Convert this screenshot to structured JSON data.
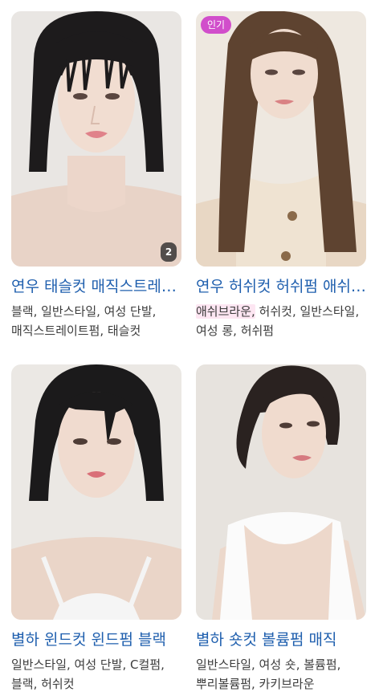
{
  "cards": [
    {
      "title": "연우 태슬컷 매직스트레이트펌",
      "tags": "블랙, 일반스타일, 여성 단발, 매직스트레이트펌, 태슬컷",
      "photo_count": "2"
    },
    {
      "title": "연우 허쉬컷 허쉬펌 애쉬브라운",
      "badge": "인기",
      "tag_highlight": "애쉬브라운,",
      "tags_rest": " 허쉬컷, 일반스타일, 여성 롱, 허쉬펌"
    },
    {
      "title": "별하 윈드컷 윈드펌 블랙",
      "tags": "일반스타일, 여성 단발, C컬펌, 블랙, 허쉬컷"
    },
    {
      "title": "별하 숏컷 볼륨펌 매직",
      "tags": "일반스타일, 여성 숏, 볼륨펌, 뿌리볼륨펌, 카키브라운"
    }
  ],
  "colors": {
    "title": "#1f5fae",
    "tags": "#3c3c3c",
    "badge_popular": "#d14ecb",
    "highlight": "#fde6f2"
  }
}
